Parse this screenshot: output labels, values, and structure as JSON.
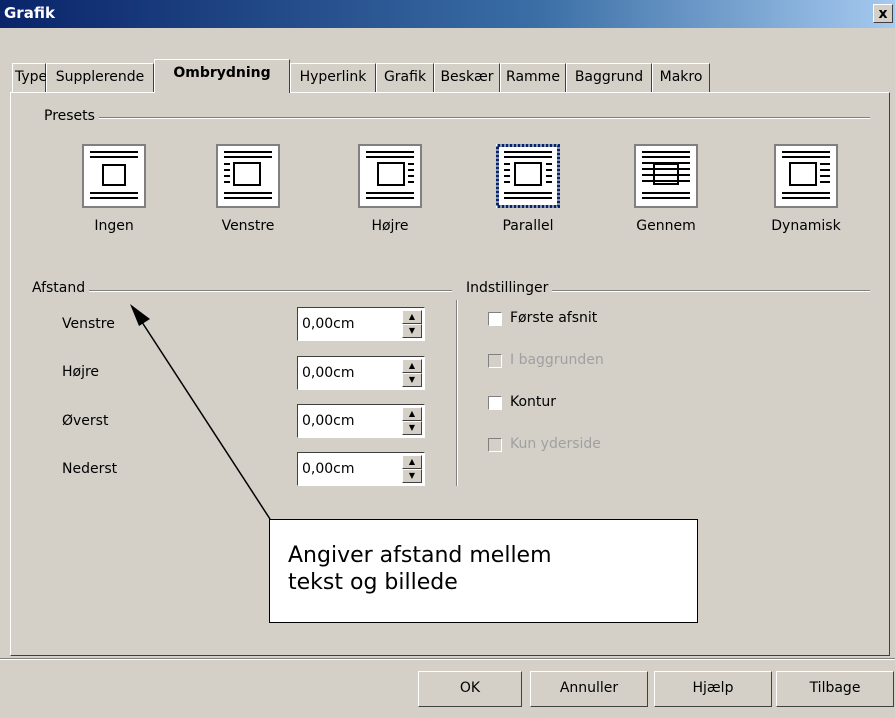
{
  "window": {
    "title": "Grafik",
    "close": "x"
  },
  "tabs": [
    "Type",
    "Supplerende",
    "Ombrydning",
    "Hyperlink",
    "Grafik",
    "Beskær",
    "Ramme",
    "Baggrund",
    "Makro"
  ],
  "active_tab": "Ombrydning",
  "presets": {
    "group_label": "Presets",
    "items": [
      {
        "label": "Ingen",
        "selected": false
      },
      {
        "label": "Venstre",
        "selected": false
      },
      {
        "label": "Højre",
        "selected": false
      },
      {
        "label": "Parallel",
        "selected": true
      },
      {
        "label": "Gennem",
        "selected": false
      },
      {
        "label": "Dynamisk",
        "selected": false
      }
    ]
  },
  "afstand": {
    "group_label": "Afstand",
    "fields": [
      {
        "label": "Venstre",
        "value": "0,00cm"
      },
      {
        "label": "Højre",
        "value": "0,00cm"
      },
      {
        "label": "Øverst",
        "value": "0,00cm"
      },
      {
        "label": "Nederst",
        "value": "0,00cm"
      }
    ]
  },
  "indstillinger": {
    "group_label": "Indstillinger",
    "options": [
      {
        "label": "Første afsnit",
        "enabled": true,
        "checked": false
      },
      {
        "label": "I baggrunden",
        "enabled": false,
        "checked": false
      },
      {
        "label": "Kontur",
        "enabled": true,
        "checked": false
      },
      {
        "label": "Kun yderside",
        "enabled": false,
        "checked": false
      }
    ]
  },
  "callout": {
    "line1": "Angiver afstand mellem",
    "line2": "tekst og billede"
  },
  "buttons": {
    "ok": "OK",
    "cancel": "Annuller",
    "help": "Hjælp",
    "reset": "Tilbage"
  }
}
